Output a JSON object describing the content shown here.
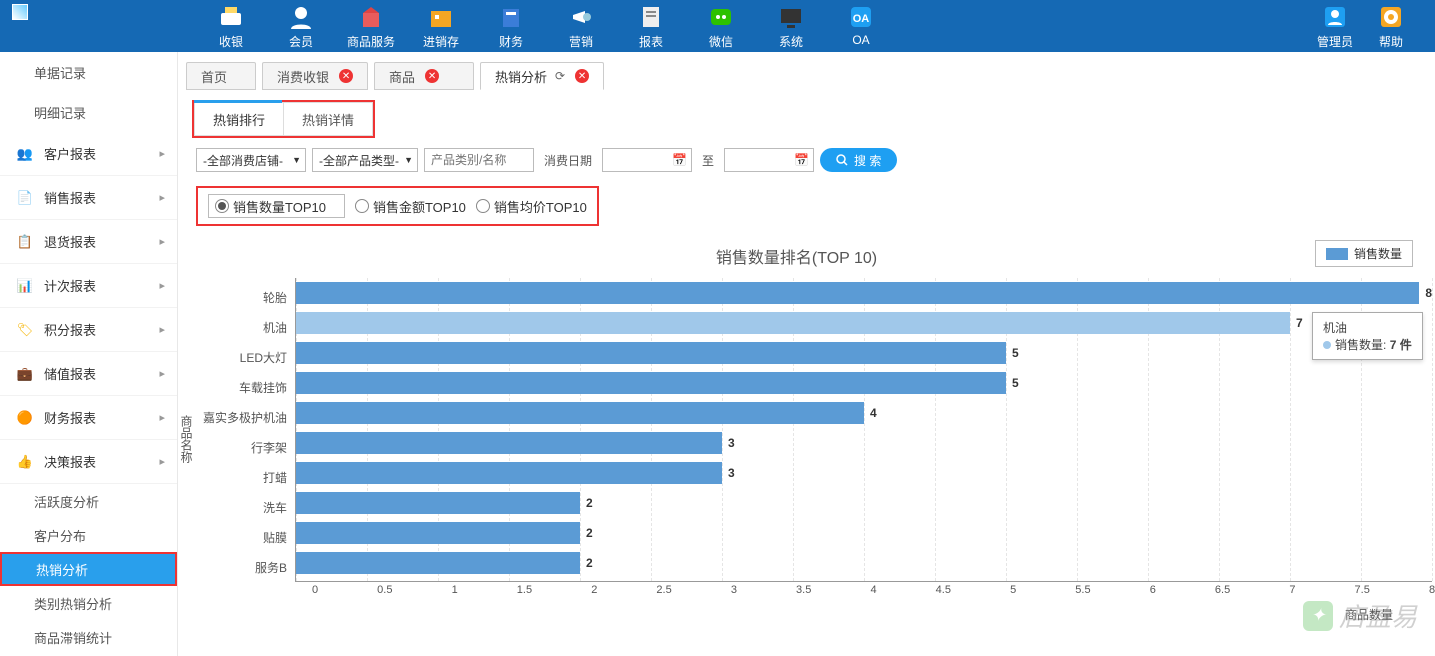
{
  "topnav": {
    "items": [
      {
        "label": "收银",
        "icon": "cashier"
      },
      {
        "label": "会员",
        "icon": "member"
      },
      {
        "label": "商品服务",
        "icon": "goods"
      },
      {
        "label": "进销存",
        "icon": "inventory"
      },
      {
        "label": "财务",
        "icon": "finance"
      },
      {
        "label": "营销",
        "icon": "marketing"
      },
      {
        "label": "报表",
        "icon": "report"
      },
      {
        "label": "微信",
        "icon": "wechat"
      },
      {
        "label": "系统",
        "icon": "system"
      },
      {
        "label": "OA",
        "icon": "oa"
      }
    ],
    "right": [
      {
        "label": "管理员",
        "icon": "admin"
      },
      {
        "label": "帮助",
        "icon": "help"
      }
    ]
  },
  "sidebar": {
    "items1": [
      {
        "label": "单据记录"
      },
      {
        "label": "明细记录"
      }
    ],
    "groups": [
      {
        "label": "客户报表",
        "color": "#555"
      },
      {
        "label": "销售报表",
        "color": "#e85c5c"
      },
      {
        "label": "退货报表",
        "color": "#5b9bd5"
      },
      {
        "label": "计次报表",
        "color": "#f2a23c"
      },
      {
        "label": "积分报表",
        "color": "#f5b400"
      },
      {
        "label": "储值报表",
        "color": "#a0522d"
      },
      {
        "label": "财务报表",
        "color": "#f2a23c"
      },
      {
        "label": "决策报表",
        "color": "#e36"
      }
    ],
    "subs": [
      {
        "label": "活跃度分析"
      },
      {
        "label": "客户分布"
      },
      {
        "label": "热销分析",
        "active": true
      },
      {
        "label": "类别热销分析"
      },
      {
        "label": "商品滞销统计"
      }
    ]
  },
  "tabs": [
    {
      "label": "首页",
      "closable": false
    },
    {
      "label": "消费收银",
      "closable": true
    },
    {
      "label": "商品",
      "closable": true
    },
    {
      "label": "热销分析",
      "closable": true,
      "active": true,
      "refresh": true
    }
  ],
  "subtabs": [
    {
      "label": "热销排行",
      "active": true
    },
    {
      "label": "热销详情"
    }
  ],
  "filters": {
    "store": "-全部消费店铺-",
    "ptype": "-全部产品类型-",
    "search_placeholder": "产品类别/名称",
    "date_label": "消费日期",
    "to": "至",
    "search_btn": "搜 索"
  },
  "radios": [
    {
      "label": "销售数量TOP10",
      "selected": true
    },
    {
      "label": "销售金额TOP10"
    },
    {
      "label": "销售均价TOP10"
    }
  ],
  "chart_data": {
    "type": "bar",
    "orientation": "horizontal",
    "title": "销售数量排名(TOP 10)",
    "ylabel": "商品名称",
    "xlabel": "商品数量",
    "legend": "销售数量",
    "categories": [
      "轮胎",
      "机油",
      "LED大灯",
      "车载挂饰",
      "嘉实多极护机油",
      "行李架",
      "打蜡",
      "洗车",
      "贴膜",
      "服务B"
    ],
    "values": [
      8,
      7,
      5,
      5,
      4,
      3,
      3,
      2,
      2,
      2
    ],
    "xlim": [
      0,
      8
    ],
    "xticks": [
      0,
      0.5,
      1.0,
      1.5,
      2.0,
      2.5,
      3.0,
      3.5,
      4.0,
      4.5,
      5.0,
      5.5,
      6.0,
      6.5,
      7.0,
      7.5,
      8
    ],
    "highlight_index": 1,
    "tooltip": {
      "name": "机油",
      "series": "销售数量",
      "value": "7 件"
    }
  },
  "watermark": "店盈易"
}
